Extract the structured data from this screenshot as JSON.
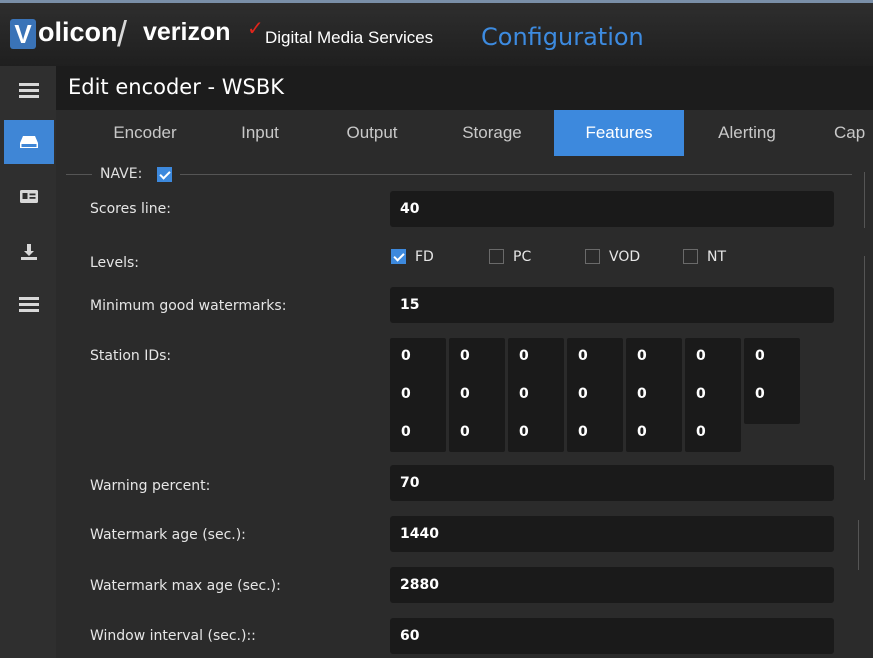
{
  "brand": {
    "logo_v": "V",
    "logo_rest": "olicon",
    "slash": "/",
    "partner": "verizon",
    "partner_mark": "✓",
    "product": "Digital Media Services",
    "section": "Configuration"
  },
  "header": {
    "title": "Edit encoder - WSBK"
  },
  "nav": {
    "items": [
      {
        "name": "menu",
        "icon": "hamburger-icon",
        "active": false
      },
      {
        "name": "encoders",
        "icon": "drive-icon",
        "active": true
      },
      {
        "name": "id-card",
        "icon": "id-card-icon",
        "active": false
      },
      {
        "name": "download",
        "icon": "download-icon",
        "active": false
      },
      {
        "name": "list",
        "icon": "list-icon",
        "active": false
      }
    ]
  },
  "tabs": [
    {
      "label": "Encoder",
      "active": false
    },
    {
      "label": "Input",
      "active": false
    },
    {
      "label": "Output",
      "active": false
    },
    {
      "label": "Storage",
      "active": false
    },
    {
      "label": "Features",
      "active": true
    },
    {
      "label": "Alerting",
      "active": false
    },
    {
      "label": "Cap",
      "active": false
    }
  ],
  "nave": {
    "label": "NAVE:",
    "checked": true
  },
  "fields": {
    "scores_line": {
      "label": "Scores line:",
      "value": "40"
    },
    "levels": {
      "label": "Levels:",
      "options": [
        {
          "label": "FD",
          "checked": true
        },
        {
          "label": "PC",
          "checked": false
        },
        {
          "label": "VOD",
          "checked": false
        },
        {
          "label": "NT",
          "checked": false
        }
      ]
    },
    "min_good_watermarks": {
      "label": "Minimum good watermarks:",
      "value": "15"
    },
    "station_ids": {
      "label": "Station IDs:",
      "rows": [
        [
          "0",
          "0",
          "0",
          "0",
          "0",
          "0",
          "0"
        ],
        [
          "0",
          "0",
          "0",
          "0",
          "0",
          "0",
          "0"
        ],
        [
          "0",
          "0",
          "0",
          "0",
          "0",
          "0"
        ]
      ]
    },
    "warning_percent": {
      "label": "Warning percent:",
      "value": "70"
    },
    "watermark_age": {
      "label": "Watermark age (sec.):",
      "value": "1440"
    },
    "watermark_max_age": {
      "label": "Watermark max age (sec.):",
      "value": "2880"
    },
    "window_interval": {
      "label": "Window interval (sec.)::",
      "value": "60"
    }
  },
  "colors": {
    "accent": "#3d89dd",
    "background": "#2b2b2b",
    "input_bg": "#1a1a1a",
    "verizon_red": "#e0251b"
  }
}
